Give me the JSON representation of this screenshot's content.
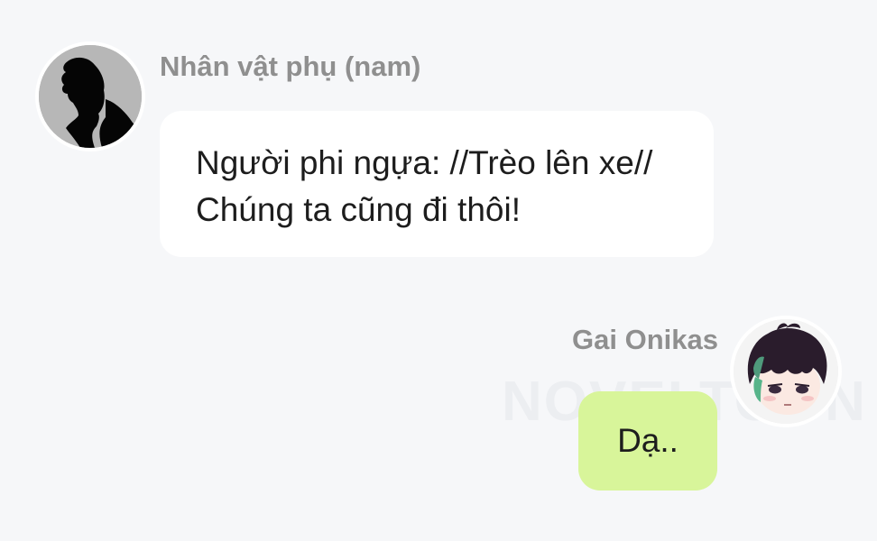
{
  "watermark": {
    "text": "NOVELTOON"
  },
  "messages": [
    {
      "side": "left",
      "sender": "Nhân vật phụ (nam)",
      "avatar_icon": "male-silhouette-avatar",
      "text": "Người phi ngựa: //Trèo lên xe// Chúng ta cũng đi thôi!",
      "bubble_color": "#ffffff"
    },
    {
      "side": "right",
      "sender": "Gai Onikas",
      "avatar_icon": "anime-boy-avatar",
      "text": "Dạ..",
      "bubble_color": "#d8f59a"
    }
  ],
  "colors": {
    "background": "#f6f7f9",
    "sender_name": "#8f8f8f",
    "message_text": "#1d1d1d"
  }
}
